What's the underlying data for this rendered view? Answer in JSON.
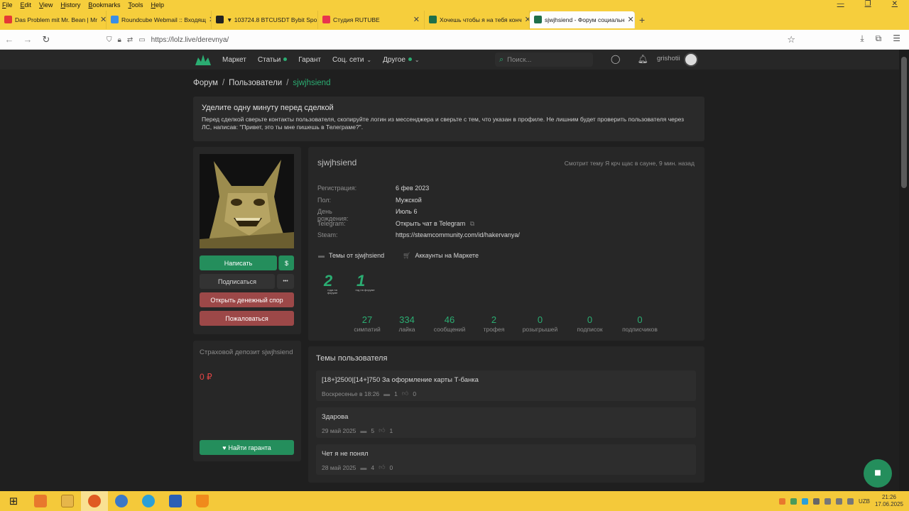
{
  "browser": {
    "menu": [
      "File",
      "Edit",
      "View",
      "History",
      "Bookmarks",
      "Tools",
      "Help"
    ],
    "tabs": [
      {
        "label": "Das Problem mit Mr. Bean | Mr",
        "color": "#e53935",
        "active": false
      },
      {
        "label": "Roundcube Webmail :: Входящ",
        "color": "#3a8ee6",
        "active": false
      },
      {
        "label": "▼ 103724.8 BTCUSDT Bybit Spo",
        "color": "#222222",
        "active": false
      },
      {
        "label": "Студия RUTUBE",
        "color": "#e8344e",
        "active": false
      },
      {
        "label": "Хочешь чтобы я на тебя конч",
        "color": "#1f6f4a",
        "active": false
      },
      {
        "label": "sjwjhsiend - Форум социальн",
        "color": "#1f6f4a",
        "active": true
      }
    ],
    "url": "https://lolz.live/derevnya/"
  },
  "header": {
    "nav": [
      {
        "label": "Маркет",
        "dot": false,
        "caret": false
      },
      {
        "label": "Статьи",
        "dot": true,
        "caret": false
      },
      {
        "label": "Гарант",
        "dot": false,
        "caret": false
      },
      {
        "label": "Соц. сети",
        "dot": false,
        "caret": true
      },
      {
        "label": "Другое",
        "dot": true,
        "caret": true
      }
    ],
    "search_placeholder": "Поиск...",
    "username": "grishotii"
  },
  "breadcrumb": [
    "Форум",
    "Пользователи",
    "sjwjhsiend"
  ],
  "notice": {
    "title": "Уделите одну минуту перед сделкой",
    "body": "Перед сделкой сверьте контакты пользователя, скопируйте логин из мессенджера и сверьте с тем, что указан в профиле. Не лишним будет проверить пользователя через ЛС, написав: \"Привет, это ты мне пишешь в Телеграме?\"."
  },
  "sidebar": {
    "write": "Написать",
    "dollar": "$",
    "subscribe": "Подписаться",
    "more": "•••",
    "dispute": "Открыть денежный спор",
    "report": "Пожаловаться",
    "deposit_label": "Страховой депозит sjwjhsiend",
    "deposit_amount": "0 ₽",
    "guarantor": "Найти гаранта"
  },
  "profile": {
    "name": "sjwjhsiend",
    "status": "Смотрит тему Я крч щас в сауне, 9 мин. назад",
    "info": [
      {
        "key": "Регистрация:",
        "value": "6 фев 2023"
      },
      {
        "key": "Пол:",
        "value": "Мужской"
      },
      {
        "key": "День рождения:",
        "value": "Июль 6"
      },
      {
        "key": "Telegram:",
        "value": "Открыть чат в Telegram"
      },
      {
        "key": "Steam:",
        "value": "https://steamcommunity.com/id/hakervanya/"
      }
    ],
    "links": [
      "Темы от sjwjhsiend",
      "Аккаунты на Маркете"
    ],
    "trophies": [
      {
        "num": "2",
        "sub": "года на форуме"
      },
      {
        "num": "1",
        "sub": "год на форуме"
      }
    ],
    "stats": [
      {
        "value": "27",
        "label": "симпатий"
      },
      {
        "value": "334",
        "label": "лайка"
      },
      {
        "value": "46",
        "label": "сообщений"
      },
      {
        "value": "2",
        "label": "трофея"
      },
      {
        "value": "0",
        "label": "розыгрышей"
      },
      {
        "value": "0",
        "label": "подписок"
      },
      {
        "value": "0",
        "label": "подписчиков"
      }
    ]
  },
  "threads": {
    "title": "Темы пользователя",
    "items": [
      {
        "title": "[18+]2500|[14+]750 За оформление карты Т-банка",
        "date": "Воскресенье в 18:26",
        "replies": "1",
        "likes": "0"
      },
      {
        "title": "Здарова",
        "date": "29 май 2025",
        "replies": "5",
        "likes": "1"
      },
      {
        "title": "Чет я не понял",
        "date": "28 май 2025",
        "replies": "4",
        "likes": "0"
      }
    ]
  },
  "taskbar": {
    "lang": "UZB",
    "time": "21:26",
    "date": "17.06.2025"
  }
}
